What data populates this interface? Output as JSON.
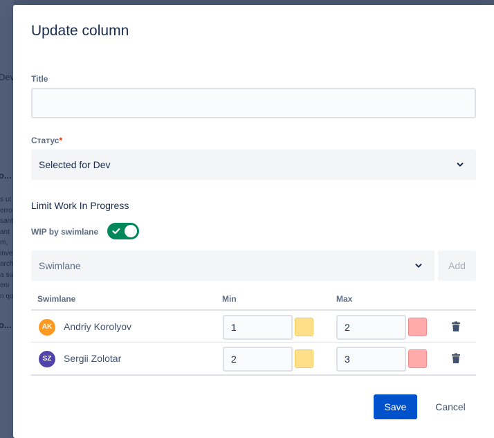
{
  "background": {
    "fragments": [
      "Dev",
      "o...",
      "o..."
    ],
    "text_lines": [
      "s ut",
      "erro",
      "sant",
      "ant",
      "m,",
      "inve",
      "arch",
      "a su",
      "eni",
      "n qu"
    ]
  },
  "modal": {
    "title": "Update column",
    "title_field": {
      "label": "Title",
      "value": "",
      "placeholder": ""
    },
    "status": {
      "label": "Статус",
      "required_mark": "*",
      "value": "Selected for Dev"
    },
    "wip": {
      "section_title": "Limit Work In Progress",
      "toggle_label": "WIP by swimlane",
      "toggle_on": true,
      "swimlane_placeholder": "Swimlane",
      "add_label": "Add"
    },
    "table": {
      "headers": {
        "swimlane": "Swimlane",
        "min": "Min",
        "max": "Max"
      },
      "rows": [
        {
          "initials": "AK",
          "avatar_color": "#ff991f",
          "name": "Andriy Korolyov",
          "min": "1",
          "max": "2",
          "min_color": "#ffe08a",
          "max_color": "#ffabab"
        },
        {
          "initials": "SZ",
          "avatar_color": "#5243aa",
          "name": "Sergii Zolotar",
          "min": "2",
          "max": "3",
          "min_color": "#ffe08a",
          "max_color": "#ffabab"
        }
      ]
    },
    "footer": {
      "save_label": "Save",
      "cancel_label": "Cancel"
    }
  },
  "colors": {
    "primary": "#0052cc",
    "toggle_on": "#00875a",
    "required": "#de350b"
  },
  "icons": [
    "chevron-down-icon",
    "check-icon",
    "trash-icon"
  ]
}
